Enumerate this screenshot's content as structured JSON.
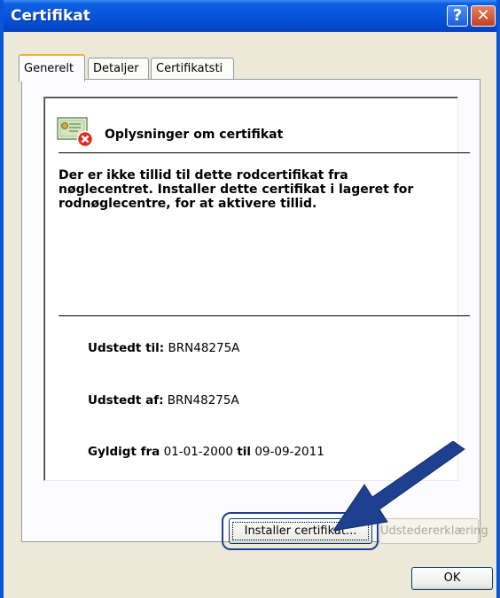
{
  "window": {
    "title": "Certifikat",
    "help_glyph": "?",
    "close_glyph": "✕"
  },
  "tabs": [
    {
      "label": "Generelt"
    },
    {
      "label": "Detaljer"
    },
    {
      "label": "Certifikatsti"
    }
  ],
  "info": {
    "title": "Oplysninger om certifikat",
    "message": "Der er ikke tillid til dette rodcertifikat fra\nnøglecentret. Installer dette certifikat i lageret for\nrodnøglecentre, for at aktivere tillid."
  },
  "issued_to": {
    "label": "Udstedt til:",
    "value": "BRN48275A"
  },
  "issued_by": {
    "label": "Udstedt af:",
    "value": "BRN48275A"
  },
  "valid": {
    "from_label": "Gyldigt fra",
    "from": "01-01-2000",
    "to_label": "til",
    "to": "09-09-2011"
  },
  "buttons": {
    "install": "Installer certifikat...",
    "issuer_statement": "Udstedererklæring",
    "ok": "OK"
  },
  "colors": {
    "title_bar": "#0754dc",
    "annotation_arrow": "#1f3f8f",
    "error_badge": "#e02b20"
  },
  "icons": [
    "help-icon",
    "close-icon",
    "certificate-error-icon",
    "annotation-arrow-icon"
  ]
}
